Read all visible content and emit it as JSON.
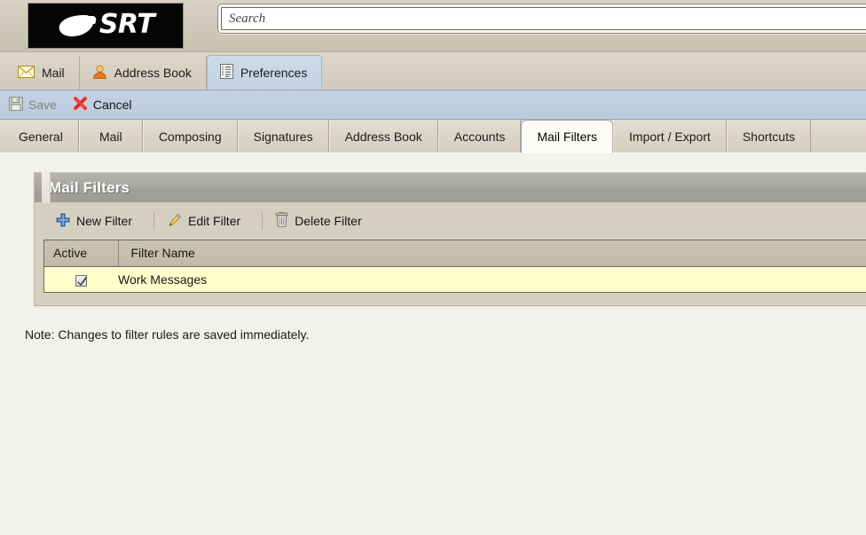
{
  "banner": {
    "logo_text": "SRT",
    "logo_icon": "swoosh-shell-icon",
    "search": {
      "placeholder": "Search",
      "value": ""
    }
  },
  "app_tabs": [
    {
      "label": "Mail",
      "icon": "envelope-icon",
      "active": false
    },
    {
      "label": "Address Book",
      "icon": "person-icon",
      "active": false
    },
    {
      "label": "Preferences",
      "icon": "list-page-icon",
      "active": true
    }
  ],
  "action_bar": {
    "save": {
      "label": "Save",
      "icon": "floppy-disk-icon",
      "enabled": false
    },
    "cancel": {
      "label": "Cancel",
      "icon": "red-x-icon",
      "enabled": true
    }
  },
  "pref_tabs": [
    {
      "label": "General",
      "active": false
    },
    {
      "label": "Mail",
      "active": false
    },
    {
      "label": "Composing",
      "active": false
    },
    {
      "label": "Signatures",
      "active": false
    },
    {
      "label": "Address Book",
      "active": false
    },
    {
      "label": "Accounts",
      "active": false
    },
    {
      "label": "Mail Filters",
      "active": true
    },
    {
      "label": "Import / Export",
      "active": false
    },
    {
      "label": "Shortcuts",
      "active": false
    }
  ],
  "panel": {
    "title": "Mail Filters",
    "toolbar": [
      {
        "label": "New Filter",
        "icon": "blue-plus-icon"
      },
      {
        "label": "Edit Filter",
        "icon": "yellow-pencil-icon"
      },
      {
        "label": "Delete Filter",
        "icon": "trash-can-icon"
      }
    ],
    "table": {
      "columns": [
        "Active",
        "Filter Name"
      ],
      "rows": [
        {
          "active": true,
          "name": "Work Messages"
        }
      ]
    }
  },
  "note": "Note: Changes to filter rules are saved immediately.",
  "colors": {
    "banner_bg": "#cfc8b8",
    "app_tab_active": "#c3d3e3",
    "action_bar": "#bacbdd",
    "panel_header": "#a9a7a4",
    "panel_body": "#d5cfc0",
    "row_highlight": "#ffffcc",
    "content_bg": "#f2f1ec",
    "pref_tab_active": "#fdfcf9"
  }
}
